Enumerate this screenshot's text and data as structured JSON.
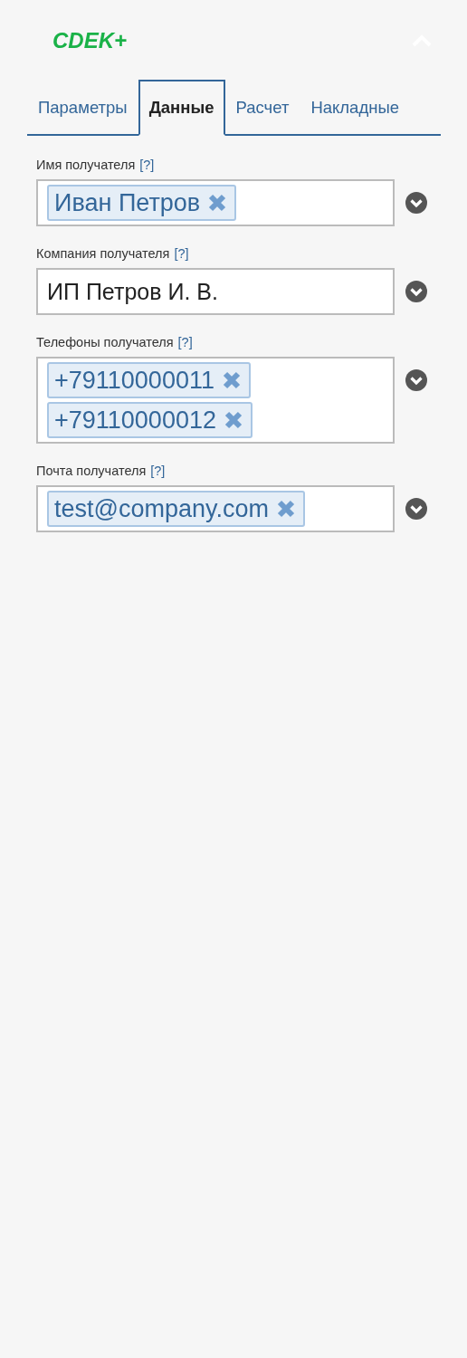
{
  "logo": "CDEK+",
  "tabs": [
    {
      "label": "Параметры",
      "selected": false
    },
    {
      "label": "Данные",
      "selected": true
    },
    {
      "label": "Расчет",
      "selected": false
    },
    {
      "label": "Накладные",
      "selected": false
    }
  ],
  "fields": [
    {
      "label": "Имя получателя",
      "help": "[?]",
      "kind": "tags",
      "tags": [
        "Иван Петров"
      ]
    },
    {
      "label": "Компания получателя",
      "help": "[?]",
      "kind": "text",
      "value": "ИП Петров И. В."
    },
    {
      "label": "Телефоны получателя",
      "help": "[?]",
      "kind": "tags",
      "tags": [
        "+79110000011",
        "+79110000012"
      ]
    },
    {
      "label": "Почта получателя",
      "help": "[?]",
      "kind": "tags",
      "tags": [
        "test@company.com"
      ]
    }
  ]
}
